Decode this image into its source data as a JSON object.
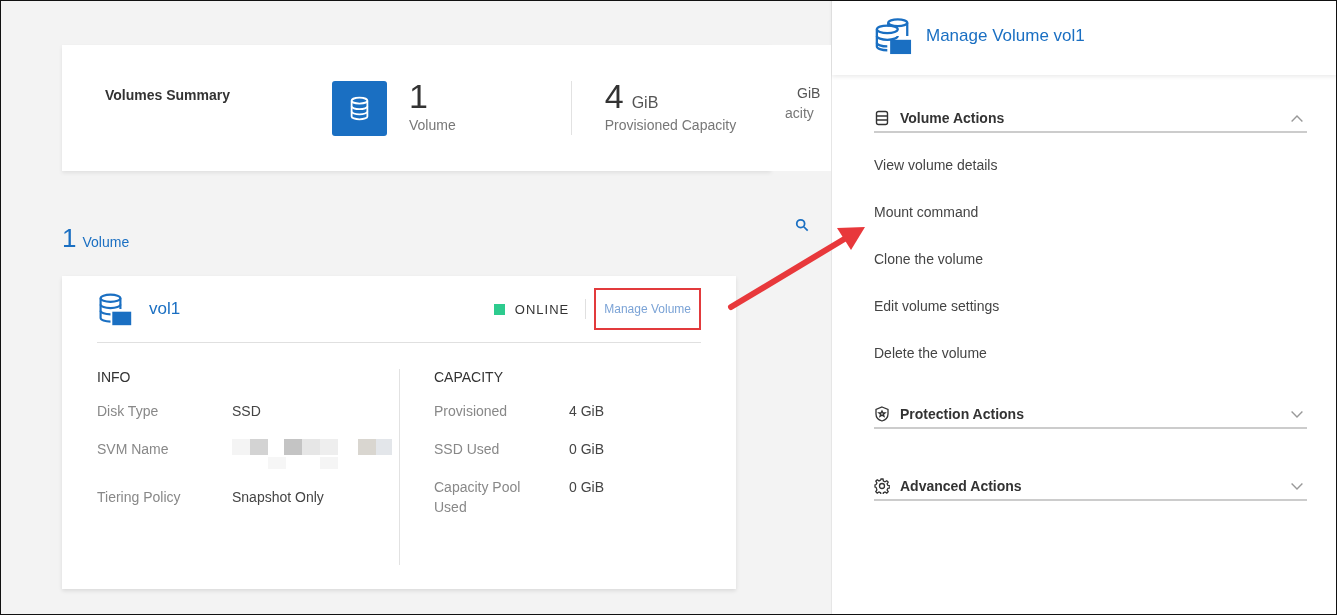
{
  "summary": {
    "title": "Volumes Summary",
    "stats": [
      {
        "value": "1",
        "label": "Volume"
      },
      {
        "value": "4",
        "unit": "GiB",
        "label": "Provisioned Capacity"
      }
    ],
    "peek": {
      "unit": "GiB",
      "label": "acity"
    }
  },
  "volume_count": {
    "number": "1",
    "label": "Volume"
  },
  "volume_card": {
    "name": "vol1",
    "status": {
      "label": "ONLINE",
      "color": "#2dcb8e"
    },
    "action": {
      "label": "Manage Volume",
      "highlighted": true
    },
    "info": {
      "title": "INFO",
      "rows": [
        {
          "label": "Disk Type",
          "value": "SSD"
        },
        {
          "label": "SVM Name",
          "kind": "redacted"
        },
        {
          "label": "Tiering Policy",
          "value": "Snapshot Only"
        }
      ]
    },
    "capacity": {
      "title": "CAPACITY",
      "rows": [
        {
          "label": "Provisioned",
          "value": "4 GiB"
        },
        {
          "label": "SSD Used",
          "value": "0 GiB"
        },
        {
          "label": "Capacity Pool Used",
          "value": "0 GiB"
        }
      ]
    }
  },
  "panel": {
    "title": "Manage Volume vol1",
    "sections": [
      {
        "kind": "volume",
        "title": "Volume Actions",
        "expanded": true,
        "items": [
          "View volume details",
          "Mount command",
          "Clone the volume",
          "Edit volume settings",
          "Delete the volume"
        ]
      },
      {
        "kind": "protection",
        "title": "Protection Actions",
        "expanded": false
      },
      {
        "kind": "advanced",
        "title": "Advanced Actions",
        "expanded": false
      }
    ]
  }
}
